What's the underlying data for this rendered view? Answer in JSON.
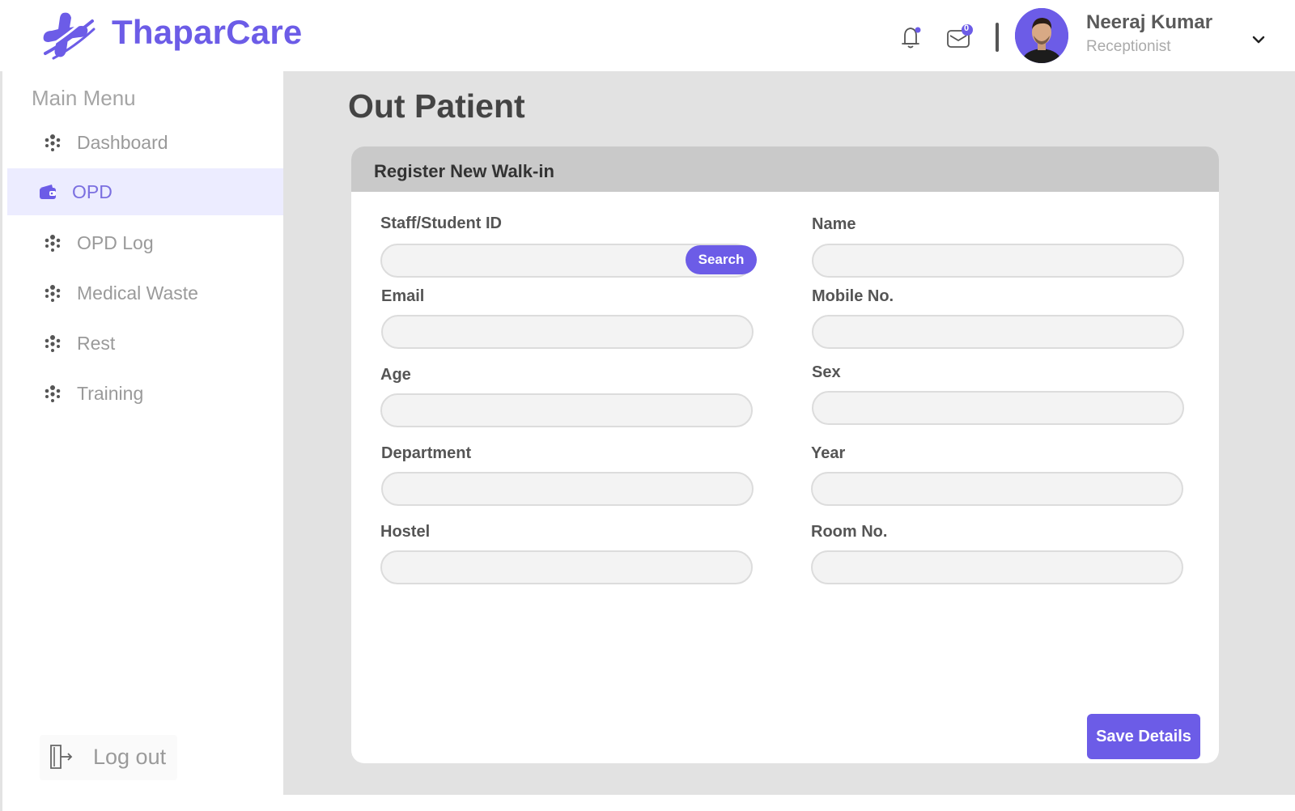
{
  "header": {
    "brand": "ThaparCare",
    "user_name": "Neeraj Kumar",
    "user_role": "Receptionist",
    "mail_badge": "0",
    "accent_color": "#6c5ce7"
  },
  "sidebar": {
    "title": "Main Menu",
    "items": [
      {
        "label": "Dashboard",
        "icon": "dots-cluster-icon",
        "active": false
      },
      {
        "label": "OPD",
        "icon": "wallet-icon",
        "active": true
      },
      {
        "label": "OPD Log",
        "icon": "dots-cluster-icon",
        "active": false
      },
      {
        "label": "Medical Waste",
        "icon": "dots-cluster-icon",
        "active": false
      },
      {
        "label": "Rest",
        "icon": "dots-cluster-icon",
        "active": false
      },
      {
        "label": "Training",
        "icon": "dots-cluster-icon",
        "active": false
      }
    ],
    "logout_label": "Log out"
  },
  "main": {
    "page_title": "Out Patient",
    "card_title": "Register New Walk-in",
    "search_label": "Search",
    "save_label": "Save Details",
    "fields": {
      "staff_id": {
        "label": "Staff/Student ID",
        "value": ""
      },
      "name": {
        "label": "Name",
        "value": ""
      },
      "email": {
        "label": "Email",
        "value": ""
      },
      "mobile": {
        "label": "Mobile No.",
        "value": ""
      },
      "age": {
        "label": "Age",
        "value": ""
      },
      "sex": {
        "label": "Sex",
        "value": ""
      },
      "department": {
        "label": "Department",
        "value": ""
      },
      "year": {
        "label": "Year",
        "value": ""
      },
      "hostel": {
        "label": "Hostel",
        "value": ""
      },
      "room": {
        "label": "Room No.",
        "value": ""
      }
    }
  }
}
